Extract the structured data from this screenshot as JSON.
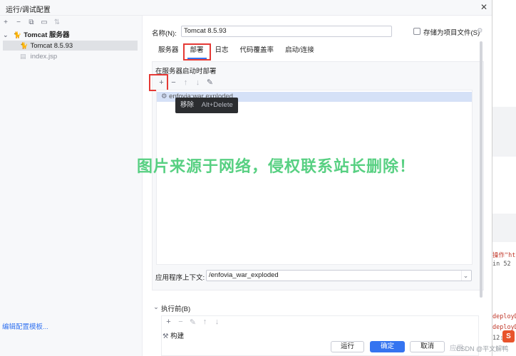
{
  "window": {
    "title": "运行/调试配置",
    "close_glyph": "✕"
  },
  "left": {
    "toolbar": [
      "+",
      "−",
      "⧉",
      "▭",
      "⇅"
    ],
    "tree": [
      {
        "label": "Tomcat 服务器",
        "expanded": true,
        "icon": "tomcat-icon"
      },
      {
        "label": "Tomcat 8.5.93",
        "selected": true,
        "icon": "tomcat-icon"
      },
      {
        "label": "index.jsp",
        "muted": true,
        "icon": "jsp-file-icon"
      }
    ],
    "edit_templates": "编辑配置模板..."
  },
  "form": {
    "name_label": "名称(N):",
    "name_value": "Tomcat 8.5.93",
    "store_as_project_file": "存储为项目文件(S)",
    "store_checked": false
  },
  "tabs": [
    {
      "label": "服务器",
      "active": false
    },
    {
      "label": "部署",
      "active": true,
      "highlighted": true
    },
    {
      "label": "日志",
      "active": false
    },
    {
      "label": "代码覆盖率",
      "active": false
    },
    {
      "label": "启动/连接",
      "active": false
    }
  ],
  "deploy": {
    "section_label": "在服务器启动时部署",
    "toolbar": [
      "+",
      "−",
      "↑",
      "↓",
      "✎"
    ],
    "artifacts": [
      "enfovia:war exploded"
    ],
    "tooltip": {
      "text": "移除",
      "shortcut": "Alt+Delete"
    },
    "context_label": "应用程序上下文:",
    "context_value": "/enfovia_war_exploded"
  },
  "before_launch": {
    "label": "执行前(B)",
    "toolbar": [
      "+",
      "−",
      "✎",
      "↑",
      "↓"
    ],
    "task": "构建"
  },
  "buttons": {
    "run": "运行",
    "ok": "确定",
    "cancel": "取消"
  },
  "watermark": "图片来源于网络，侵权联系站长删除！",
  "background_ide": {
    "lines": [
      "操作\"ht",
      "in 52",
      "deployD",
      "deployD",
      "12:3"
    ]
  },
  "csdn": "CSDN @平文解鸭",
  "colors": {
    "accent": "#3574f0",
    "highlight": "#e53935",
    "watermark": "#3cc86d"
  }
}
